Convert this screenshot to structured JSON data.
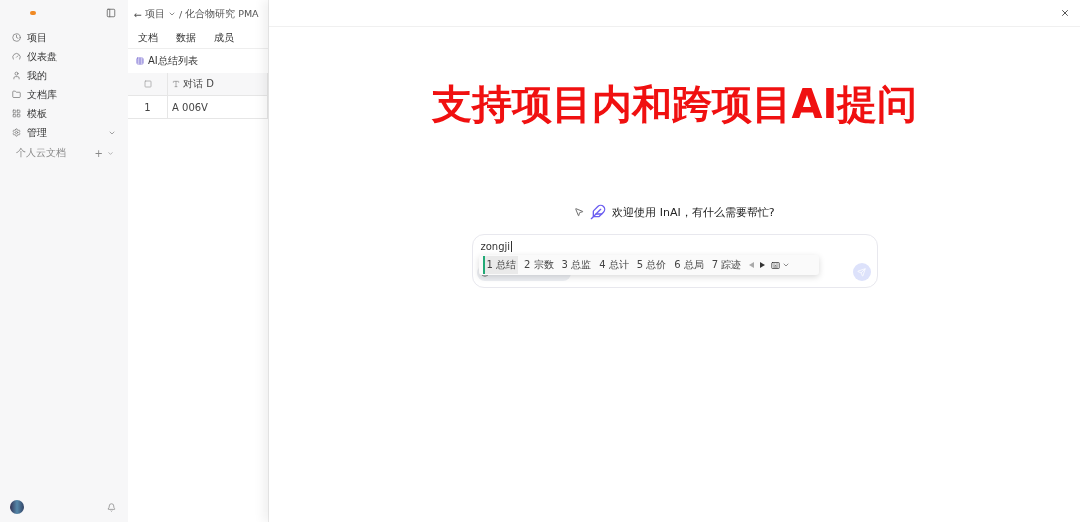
{
  "sidebar": {
    "items": [
      {
        "label": "项目",
        "kind": "clock"
      },
      {
        "label": "仪表盘",
        "kind": "gauge"
      },
      {
        "label": "我的",
        "kind": "user"
      },
      {
        "label": "文档库",
        "kind": "folder"
      },
      {
        "label": "模板",
        "kind": "grid"
      },
      {
        "label": "管理",
        "kind": "gear",
        "expandable": true
      }
    ],
    "section": {
      "label": "个人云文档",
      "add": "+"
    }
  },
  "breadcrumb": {
    "back": "←",
    "items": [
      {
        "label": "项目",
        "dropdown": true
      },
      {
        "label": "化合物研究 PMA"
      }
    ],
    "separator": "/"
  },
  "tabs": [
    {
      "label": "文档",
      "selected": false
    },
    {
      "label": "数据",
      "selected": false
    },
    {
      "label": "成员",
      "selected": false
    }
  ],
  "table": {
    "title": "AI总结列表",
    "select_all": {
      "checked": false
    },
    "columns": [
      "对话 D"
    ],
    "rows": [
      {
        "index": "1",
        "cells": [
          "A 006V"
        ]
      }
    ]
  },
  "panel": {
    "banner": "支持项目内和跨项目AI提问",
    "welcome": "欢迎使用 InAI，有什么需要帮忙?",
    "input": {
      "value": "zongji"
    },
    "candidates": [
      {
        "label": "1 总结",
        "selected": true
      },
      {
        "label": "2 宗数",
        "selected": false
      },
      {
        "label": "3 总监",
        "selected": false
      },
      {
        "label": "4 总计",
        "selected": false
      },
      {
        "label": "5 总价",
        "selected": false
      },
      {
        "label": "6 总局",
        "selected": false
      },
      {
        "label": "7 踪迹",
        "selected": false
      }
    ]
  }
}
